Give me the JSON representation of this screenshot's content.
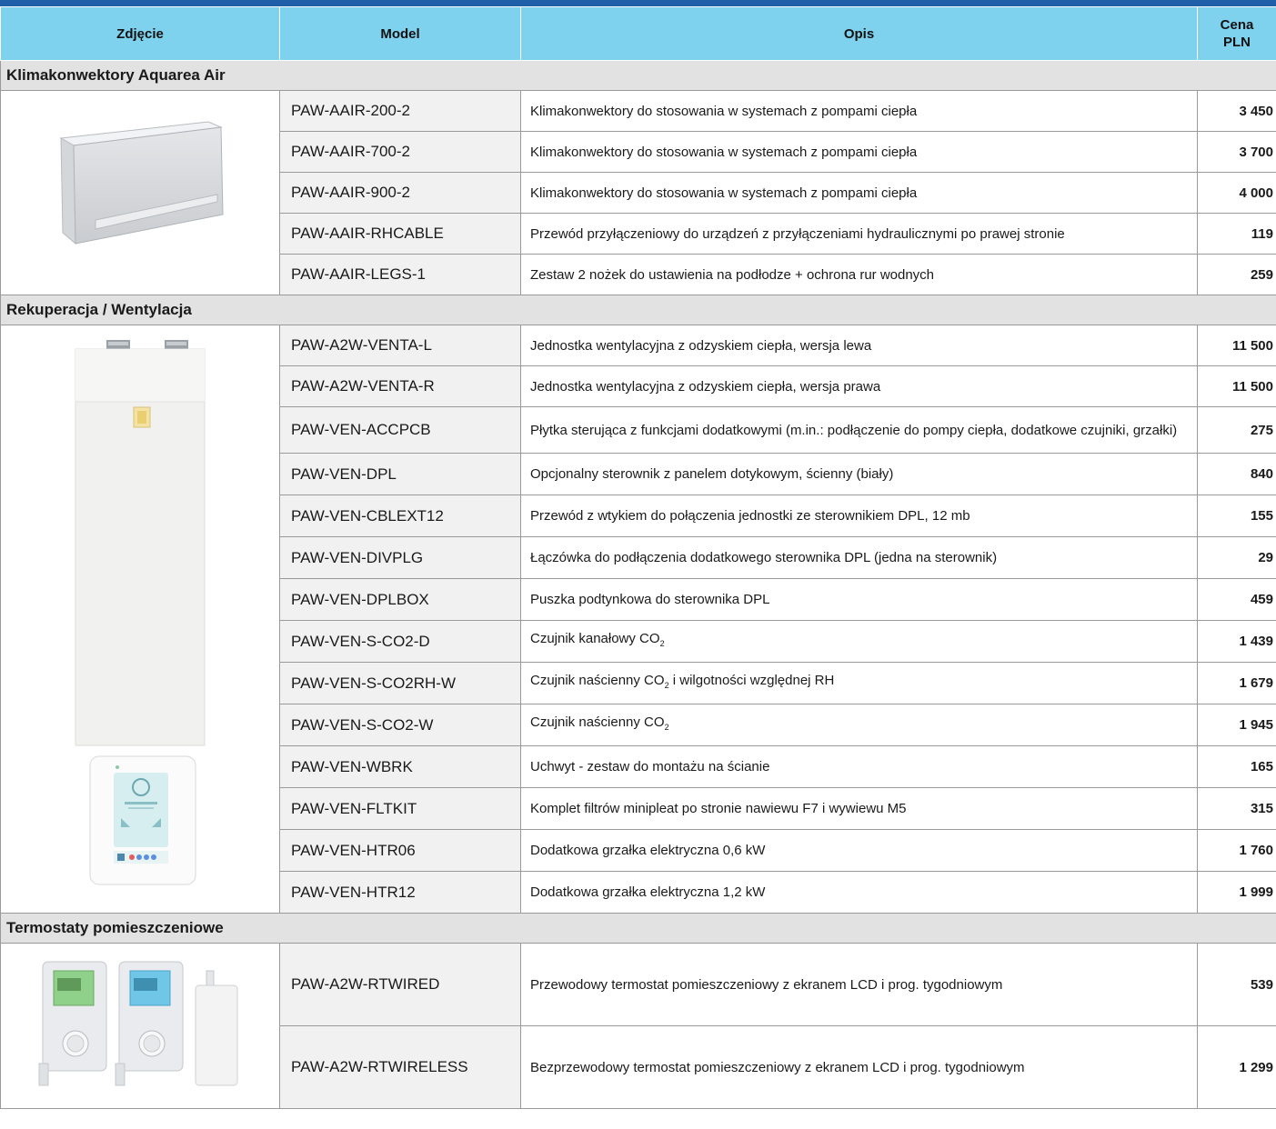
{
  "header": {
    "photo": "Zdjęcie",
    "model": "Model",
    "desc": "Opis",
    "price_line1": "Cena",
    "price_line2": "PLN"
  },
  "sections": [
    {
      "title": "Klimakonwektory Aquarea Air",
      "rows": [
        {
          "model": "PAW-AAIR-200-2",
          "desc": "Klimakonwektory do stosowania w systemach z pompami ciepła",
          "price": "3 450"
        },
        {
          "model": "PAW-AAIR-700-2",
          "desc": "Klimakonwektory do stosowania w systemach z pompami ciepła",
          "price": "3 700"
        },
        {
          "model": "PAW-AAIR-900-2",
          "desc": "Klimakonwektory do stosowania w systemach z pompami ciepła",
          "price": "4 000"
        },
        {
          "model": "PAW-AAIR-RHCABLE",
          "desc": "Przewód przyłączeniowy do urządzeń z przyłączeniami hydraulicznymi po prawej stronie",
          "price": "119"
        },
        {
          "model": "PAW-AAIR-LEGS-1",
          "desc": "Zestaw 2 nożek do ustawienia na podłodze + ochrona rur wodnych",
          "price": "259"
        }
      ]
    },
    {
      "title": "Rekuperacja / Wentylacja",
      "rows": [
        {
          "model": "PAW-A2W-VENTA-L",
          "desc": "Jednostka wentylacyjna z odzyskiem ciepła, wersja lewa",
          "price": "11 500"
        },
        {
          "model": "PAW-A2W-VENTA-R",
          "desc": "Jednostka wentylacyjna z odzyskiem ciepła, wersja prawa",
          "price": "11 500"
        },
        {
          "model": "PAW-VEN-ACCPCB",
          "desc": "Płytka sterująca z funkcjami dodatkowymi (m.in.: podłączenie do pompy ciepła, dodatkowe czujniki, grzałki)",
          "price": "275"
        },
        {
          "model": "PAW-VEN-DPL",
          "desc": "Opcjonalny sterownik z panelem dotykowym, ścienny (biały)",
          "price": "840"
        },
        {
          "model": "PAW-VEN-CBLEXT12",
          "desc": "Przewód z wtykiem do połączenia jednostki ze sterownikiem DPL, 12 mb",
          "price": "155"
        },
        {
          "model": "PAW-VEN-DIVPLG",
          "desc": "Łączówka do podłączenia dodatkowego sterownika DPL (jedna na sterownik)",
          "price": "29"
        },
        {
          "model": "PAW-VEN-DPLBOX",
          "desc": "Puszka podtynkowa do sterownika DPL",
          "price": "459"
        },
        {
          "model": "PAW-VEN-S-CO2-D",
          "desc_a": "Czujnik kanałowy CO",
          "desc_sub": "2",
          "desc_b": "",
          "price": "1 439"
        },
        {
          "model": "PAW-VEN-S-CO2RH-W",
          "desc_a": "Czujnik naścienny CO",
          "desc_sub": "2",
          "desc_b": " i wilgotności względnej RH",
          "price": "1 679"
        },
        {
          "model": "PAW-VEN-S-CO2-W",
          "desc_a": "Czujnik naścienny CO",
          "desc_sub": "2",
          "desc_b": "",
          "price": "1 945"
        },
        {
          "model": "PAW-VEN-WBRK",
          "desc": "Uchwyt - zestaw do montażu na ścianie",
          "price": "165"
        },
        {
          "model": "PAW-VEN-FLTKIT",
          "desc": "Komplet filtrów minipleat po stronie nawiewu F7 i wywiewu M5",
          "price": "315"
        },
        {
          "model": "PAW-VEN-HTR06",
          "desc": "Dodatkowa grzałka elektryczna 0,6 kW",
          "price": "1 760"
        },
        {
          "model": "PAW-VEN-HTR12",
          "desc": "Dodatkowa grzałka elektryczna 1,2 kW",
          "price": "1 999"
        }
      ]
    },
    {
      "title": "Termostaty pomieszczeniowe",
      "rows": [
        {
          "model": "PAW-A2W-RTWIRED",
          "desc": "Przewodowy termostat pomieszczeniowy z ekranem LCD i prog. tygodniowym",
          "price": "539"
        },
        {
          "model": "PAW-A2W-RTWIRELESS",
          "desc": "Bezprzewodowy termostat pomieszczeniowy z ekranem LCD i prog. tygodniowym",
          "price": "1 299"
        }
      ]
    }
  ],
  "images": {
    "fan_coil": "fan-coil-unit-photo",
    "ventilation_unit": "ventilation-unit-photo",
    "touch_controller": "touch-panel-controller-photo",
    "thermostats": "room-thermostats-photo"
  },
  "colors": {
    "header_bg": "#7fd2ee",
    "top_bar": "#1f5fa8",
    "section_bg": "#e2e2e2",
    "model_bg": "#f1f1f1"
  }
}
